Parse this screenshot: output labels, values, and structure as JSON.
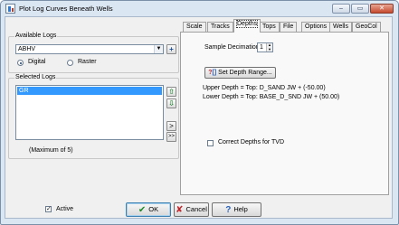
{
  "window": {
    "title": "Plot Log Curves Beneath Wells",
    "controls": {
      "minimize": "–",
      "maximize": "▭",
      "close": "✕"
    }
  },
  "left": {
    "available_logs_label": "Available Logs",
    "available_logs_value": "ABHV",
    "add_button": "+",
    "digital_label": "Digital",
    "raster_label": "Raster",
    "selected_source": "Digital",
    "selected_logs_label": "Selected Logs",
    "selected_logs": [
      "GR"
    ],
    "maximum_text": "(Maximum of 5)",
    "move_right_1": ">",
    "move_right_all": ">>"
  },
  "tabs": [
    {
      "label": "Scale"
    },
    {
      "label": "Tracks"
    },
    {
      "label": "Depths",
      "active": true
    },
    {
      "label": "Tops"
    },
    {
      "label": "File"
    },
    {
      "label": "Options"
    },
    {
      "label": "Wells"
    },
    {
      "label": "GeoCol"
    }
  ],
  "depths": {
    "sample_decimation_label": "Sample Decimation",
    "sample_decimation_value": "1",
    "set_depth_range_label": "Set Depth Range...",
    "upper_depth": "Upper Depth = Top: D_SAND JW + (-50.00)",
    "lower_depth": "Lower Depth = Top: BASE_D_SND JW + (50.00)",
    "correct_tvd_label": "Correct Depths for TVD",
    "correct_tvd_checked": false
  },
  "footer": {
    "active_label": "Active",
    "active_checked": true,
    "ok_label": "OK",
    "cancel_label": "Cancel",
    "help_label": "Help"
  },
  "colors": {
    "selection": "#3399ff",
    "ok_check": "#1f8a2a",
    "cancel_x": "#c0272d",
    "help_q": "#2a62b8",
    "arrow_green": "#2e8b3e"
  }
}
